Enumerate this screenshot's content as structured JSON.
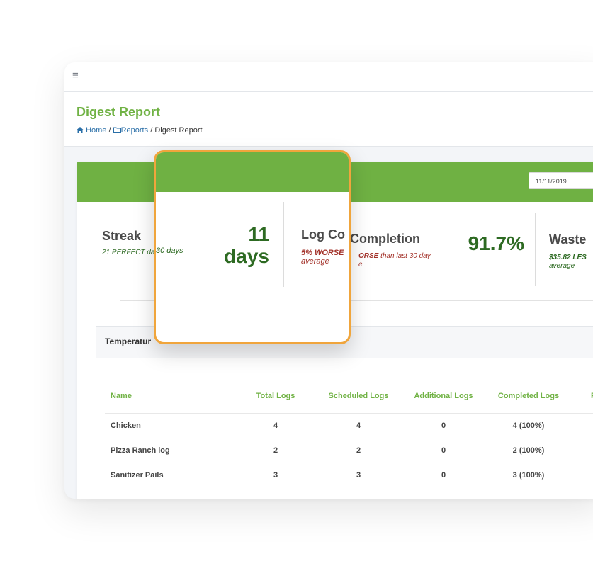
{
  "topbar": {
    "menu_icon": "hamburger-icon",
    "menu_glyph": "≡"
  },
  "page": {
    "title": "Digest Report",
    "breadcrumb": [
      {
        "label": "Home",
        "icon": "home-icon"
      },
      {
        "label": "Reports",
        "icon": "folder-icon"
      },
      {
        "label": "Digest Report"
      }
    ],
    "separator": "/"
  },
  "header": {
    "date_value": "11/11/2019"
  },
  "stats": {
    "streak": {
      "title": "Streak",
      "sub_prefix": "21 PERFECT day",
      "value": "11",
      "unit": "days",
      "popup_sub": "30 days"
    },
    "log_completion": {
      "title": "Completion",
      "title_popup": "Log Co",
      "sub_prefix": "ORSE",
      "sub_suffix": "than last 30 day",
      "sub_tail": "e",
      "popup_sub_strong": "5% WORSE",
      "popup_sub_tail": "average",
      "value": "91.7%"
    },
    "waste": {
      "title": "Waste",
      "sub_strong": "$35.82 LES",
      "sub_tail": "average"
    }
  },
  "temperature": {
    "title": "Temperatur",
    "columns": [
      "Name",
      "Total Logs",
      "Scheduled Logs",
      "Additional Logs",
      "Completed Logs",
      "F"
    ],
    "rows": [
      {
        "name": "Chicken",
        "total": "4",
        "scheduled": "4",
        "additional": "0",
        "completed": "4 (100%)"
      },
      {
        "name": "Pizza Ranch log",
        "total": "2",
        "scheduled": "2",
        "additional": "0",
        "completed": "2 (100%)"
      },
      {
        "name": "Sanitizer Pails",
        "total": "3",
        "scheduled": "3",
        "additional": "0",
        "completed": "3 (100%)"
      }
    ]
  },
  "colors": {
    "brand_green": "#6fb143",
    "dark_green": "#2d6a22",
    "worse_red": "#a3322a",
    "highlight_orange": "#f0a53c"
  }
}
